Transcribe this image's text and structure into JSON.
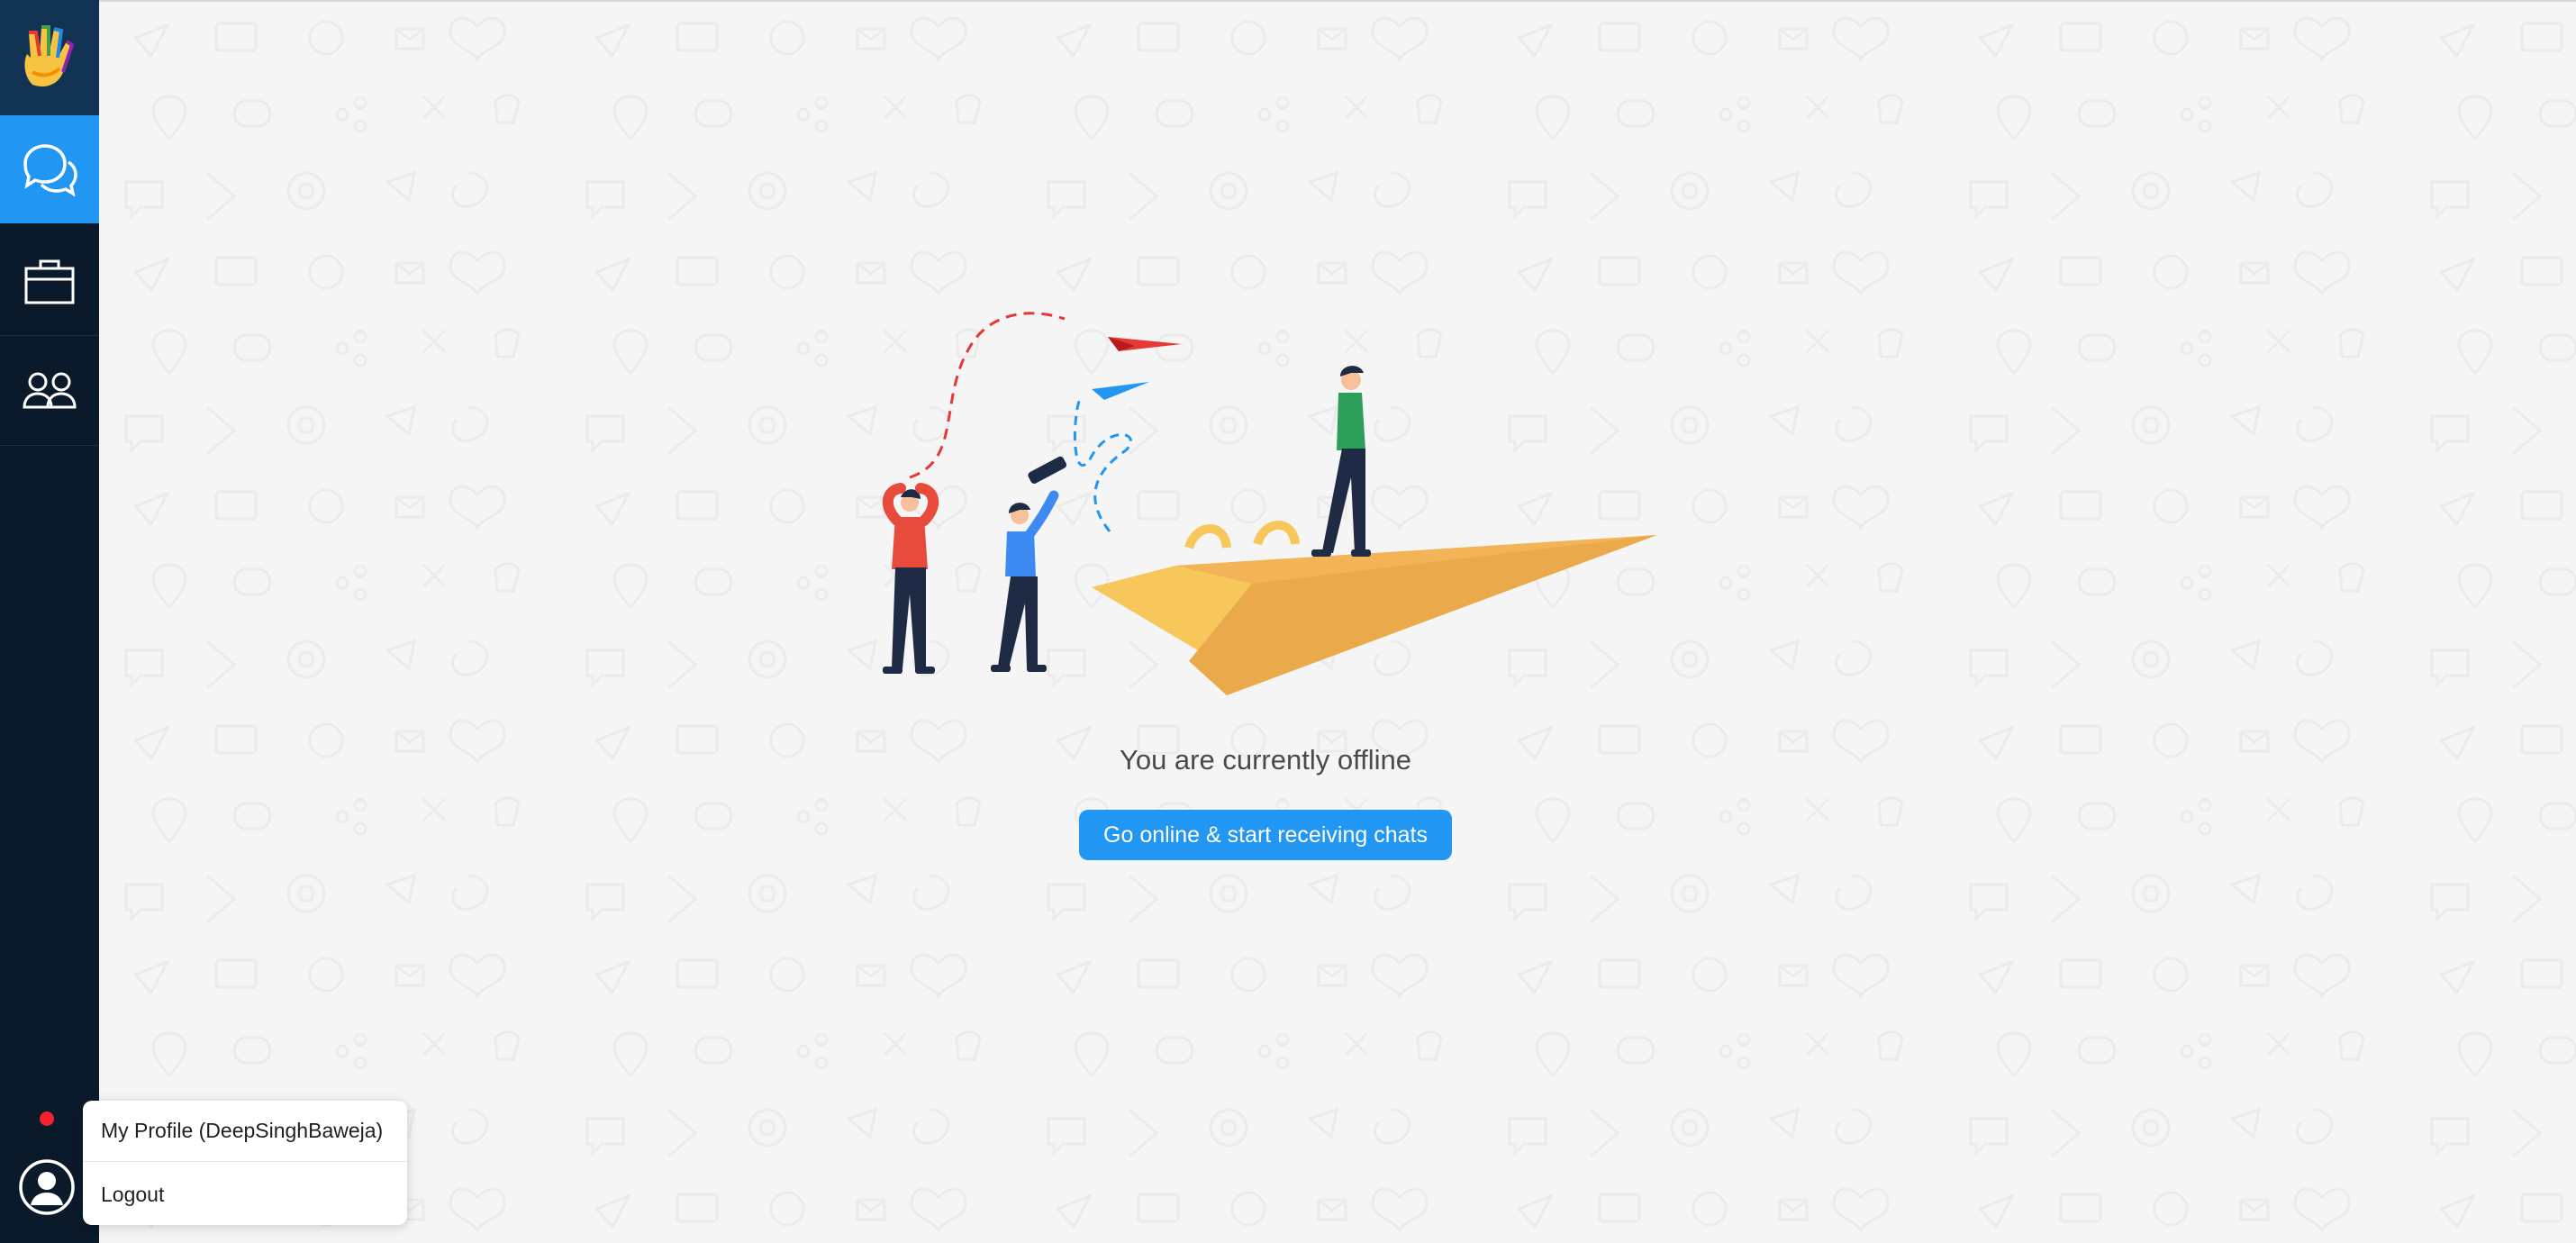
{
  "sidebar": {
    "logo": "hand-logo-icon",
    "items": [
      {
        "name": "chats",
        "icon": "chat-bubbles-icon",
        "active": true
      },
      {
        "name": "jobs",
        "icon": "briefcase-icon",
        "active": false
      },
      {
        "name": "team",
        "icon": "people-icon",
        "active": false
      }
    ],
    "status_color": "#f4212e",
    "avatar_icon": "user-avatar-icon"
  },
  "main": {
    "offline_message": "You are currently offline",
    "go_online_label": "Go online & start receiving chats"
  },
  "menu": {
    "profile_label": "My Profile (DeepSinghBaweja)",
    "logout_label": "Logout"
  },
  "colors": {
    "sidebar_bg": "#0b1a2b",
    "accent": "#2196f3",
    "page_bg": "#f5f5f5"
  }
}
